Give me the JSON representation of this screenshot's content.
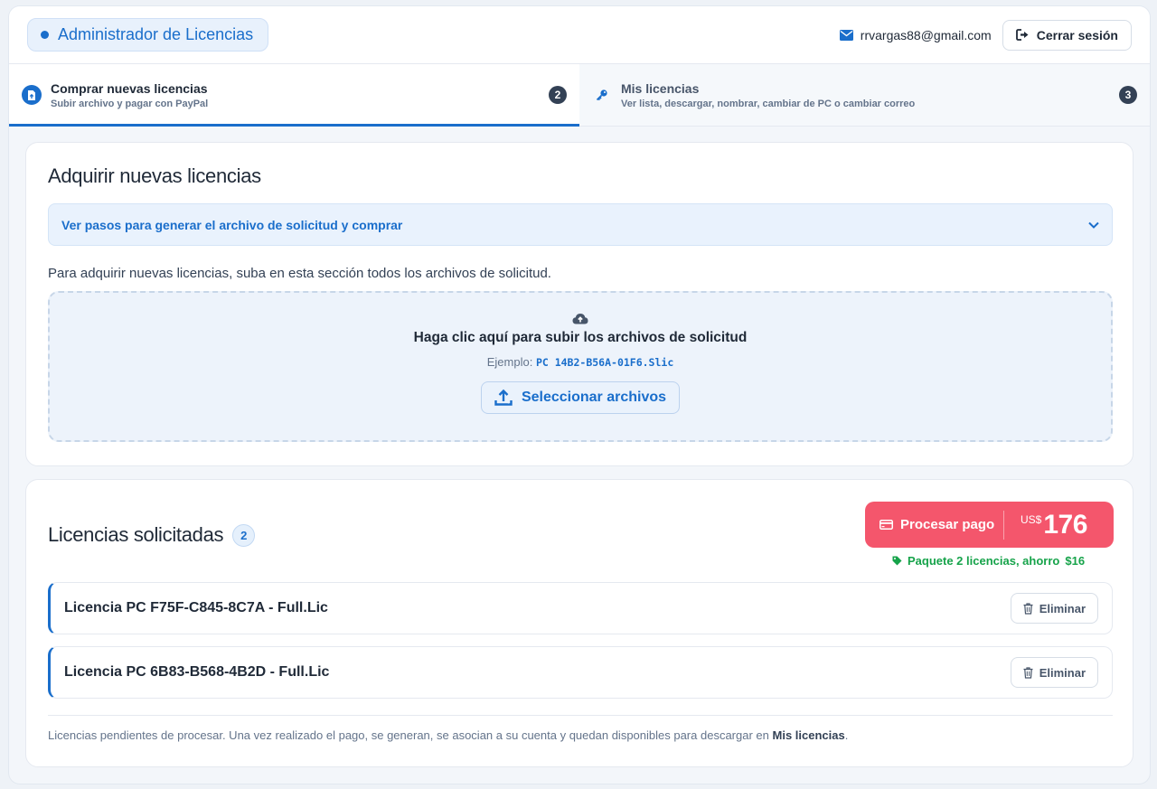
{
  "header": {
    "title": "Administrador de Licencias",
    "email": "rrvargas88@gmail.com",
    "logout_label": "Cerrar sesión"
  },
  "tabs": [
    {
      "title": "Comprar nuevas licencias",
      "subtitle": "Subir archivo y pagar con PayPal",
      "count": "2",
      "icon": "file-upload-icon",
      "active": true
    },
    {
      "title": "Mis licencias",
      "subtitle": "Ver lista, descargar, nombrar, cambiar de PC o cambiar correo",
      "count": "3",
      "icon": "key-icon",
      "active": false
    }
  ],
  "acquire": {
    "title": "Adquirir nuevas licencias",
    "accordion_label": "Ver pasos para generar el archivo de solicitud y comprar",
    "intro": "Para adquirir nuevas licencias, suba en esta sección todos los archivos de solicitud.",
    "dropzone": {
      "title": "Haga clic aquí para subir los archivos de solicitud",
      "example_label": "Ejemplo:",
      "example_file": "PC 14B2-B56A-01F6.Slic",
      "button_label": "Seleccionar archivos"
    }
  },
  "requested": {
    "title": "Licencias solicitadas",
    "count": "2",
    "pay_label": "Procesar pago",
    "currency": "US$",
    "amount": "176",
    "promo": "Paquete 2 licencias, ahorro",
    "promo_amount": "$16",
    "licenses": [
      {
        "name": "Licencia PC F75F-C845-8C7A - Full.Lic",
        "delete_label": "Eliminar"
      },
      {
        "name": "Licencia PC 6B83-B568-4B2D - Full.Lic",
        "delete_label": "Eliminar"
      }
    ],
    "footnote_prefix": "Licencias pendientes de procesar. Una vez realizado el pago, se generan, se asocian a su cuenta y quedan disponibles para descargar en",
    "footnote_link": "Mis licencias",
    "footnote_suffix": "."
  },
  "colors": {
    "accent": "#1a6ecb",
    "pay": "#f4566c",
    "promo": "#16a34a"
  }
}
